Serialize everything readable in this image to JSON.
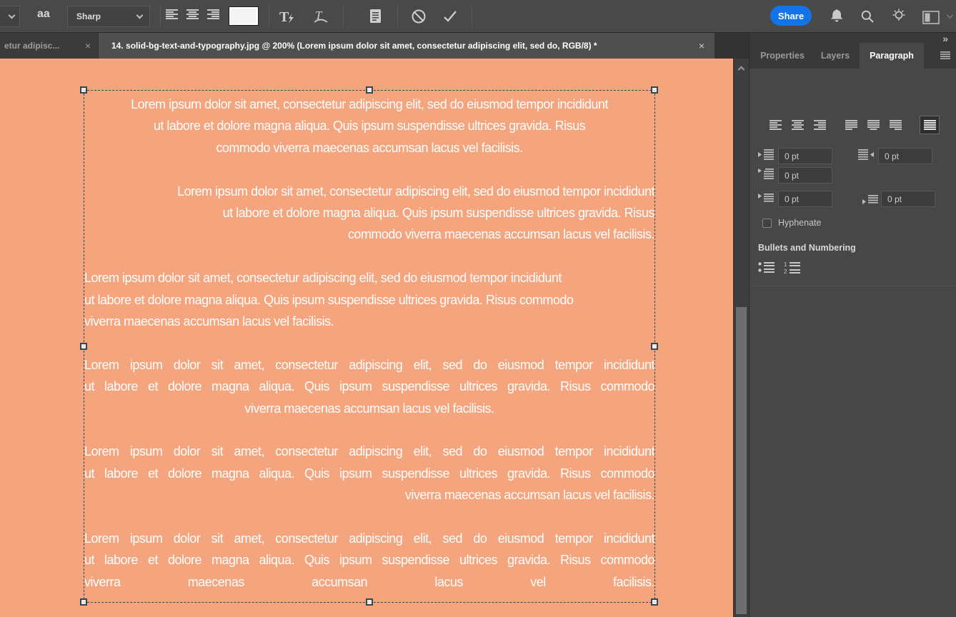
{
  "app": {
    "share_label": "Share",
    "accent_blue": "#1473E6"
  },
  "options_bar": {
    "anti_alias_icon_text": "aa",
    "anti_alias_value": "Sharp"
  },
  "doc_tabs": [
    {
      "label": "etur adipisc...",
      "close": "×",
      "active": false
    },
    {
      "label": "14. solid-bg-text-and-typography.jpg @ 200% (Lorem ipsum dolor sit amet, consectetur adipiscing elit, sed do, RGB/8) *",
      "close": "×",
      "active": true
    }
  ],
  "panel": {
    "expand_chevrons": "»",
    "tabs": [
      {
        "label": "Properties"
      },
      {
        "label": "Layers"
      },
      {
        "label": "Paragraph"
      }
    ],
    "active_tab": "Paragraph",
    "indent_left_value": "0 pt",
    "indent_right_value": "0 pt",
    "indent_first_line_value": "0 pt",
    "space_before_value": "0 pt",
    "space_after_value": "0 pt",
    "hyphenate_label": "Hyphenate",
    "hyphenate_checked": false,
    "bullets_heading": "Bullets and Numbering",
    "selected_alignment": "justify-all"
  },
  "canvas": {
    "background_color": "#F4A57E",
    "text_color": "#FFFFFF",
    "paragraphs": [
      {
        "align": "center",
        "lines": [
          "Lorem ipsum dolor sit amet, consectetur adipiscing elit, sed do eiusmod tempor incididunt",
          "ut labore et dolore magna aliqua. Quis ipsum suspendisse ultrices gravida. Risus",
          "commodo viverra maecenas accumsan lacus vel facilisis."
        ]
      },
      {
        "align": "right",
        "lines": [
          "Lorem ipsum dolor sit amet, consectetur adipiscing elit, sed do eiusmod tempor incididunt",
          "ut labore et dolore magna aliqua. Quis ipsum suspendisse ultrices gravida. Risus",
          "commodo viverra maecenas accumsan lacus vel facilisis."
        ]
      },
      {
        "align": "left",
        "lines": [
          "Lorem ipsum dolor sit amet, consectetur adipiscing elit, sed do eiusmod tempor incididunt",
          "ut labore et dolore magna aliqua. Quis ipsum suspendisse ultrices gravida. Risus commodo",
          "viverra maecenas accumsan lacus vel facilisis."
        ]
      },
      {
        "align": "justify-last-center",
        "lines": [
          "Lorem ipsum dolor sit amet, consectetur adipiscing elit, sed do eiusmod tempor incididunt",
          "ut labore et dolore magna aliqua. Quis ipsum suspendisse ultrices gravida. Risus commodo",
          "viverra maecenas accumsan lacus vel facilisis."
        ]
      },
      {
        "align": "justify-last-right",
        "lines": [
          "Lorem ipsum dolor sit amet, consectetur adipiscing elit, sed do eiusmod tempor incididunt",
          "ut labore et dolore magna aliqua. Quis ipsum suspendisse ultrices gravida. Risus commodo",
          "viverra maecenas accumsan lacus vel facilisis."
        ]
      },
      {
        "align": "justify-all",
        "lines": [
          "Lorem ipsum dolor sit amet, consectetur adipiscing elit, sed do eiusmod tempor incididunt",
          "ut labore et dolore magna aliqua. Quis ipsum suspendisse ultrices gravida. Risus commodo",
          "viverra maecenas accumsan lacus vel facilisis."
        ]
      }
    ]
  }
}
